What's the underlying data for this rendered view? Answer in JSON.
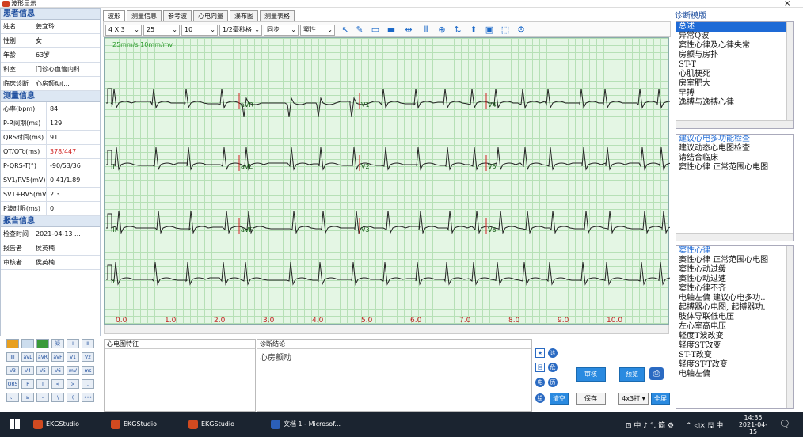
{
  "window": {
    "title": "波形显示",
    "close_glyph": "×"
  },
  "patient": {
    "header": "患者信息",
    "rows": [
      {
        "k": "姓名",
        "v": "姜宜玲"
      },
      {
        "k": "性别",
        "v": "女"
      },
      {
        "k": "年龄",
        "v": "63岁"
      },
      {
        "k": "科室",
        "v": "门诊心血管内科"
      },
      {
        "k": "临床诊断",
        "v": "心房颤动(..."
      }
    ]
  },
  "measure": {
    "header": "测量信息",
    "rows": [
      {
        "k": "心率(bpm)",
        "v": "84"
      },
      {
        "k": "P-R间期(ms)",
        "v": "129"
      },
      {
        "k": "QRS时间(ms)",
        "v": "91"
      },
      {
        "k": "QT/QTc(ms)",
        "v": "378/447"
      },
      {
        "k": "P-QRS-T(°)",
        "v": "-90/53/36"
      },
      {
        "k": "SV1/RV5(mV)",
        "v": "0.41/1.89"
      },
      {
        "k": "SV1+RV5(mV)",
        "v": "2.3"
      },
      {
        "k": "P波时限(ms)",
        "v": "0"
      }
    ]
  },
  "report": {
    "header": "报告信息",
    "rows": [
      {
        "k": "检查时间",
        "v": "2021-04-13 ..."
      },
      {
        "k": "报告者",
        "v": "侯英楠"
      },
      {
        "k": "审核者",
        "v": "侯英楠"
      }
    ]
  },
  "tabs": [
    "波形",
    "测量信息",
    "参考波",
    "心电向量",
    "瀑布图",
    "测量表格"
  ],
  "toolbar": {
    "layout": "4 X 3",
    "speed": "25",
    "gain": "10",
    "filter": "1/2毫秒格",
    "sync": "同步",
    "rhythm": "窦性"
  },
  "ecg": {
    "speed_label": "25mm/s   10mm/mv",
    "leads": [
      [
        "I",
        "aVR",
        "V1",
        "V4"
      ],
      [
        "II",
        "aVL",
        "V2",
        "V5"
      ],
      [
        "III",
        "aVF",
        "V3",
        "V6"
      ],
      [
        "II",
        "",
        "",
        ""
      ]
    ],
    "ticks": [
      "0.0",
      "1.0",
      "2.0",
      "3.0",
      "4.0",
      "5.0",
      "6.0",
      "7.0",
      "8.0",
      "9.0",
      "10.0"
    ]
  },
  "keypad": {
    "row1": [
      "",
      "",
      "",
      "疑",
      "I",
      "II"
    ],
    "row2": [
      "III",
      "aVL",
      "aVR",
      "aVF",
      "V1",
      "V2"
    ],
    "row3": [
      "V3",
      "V4",
      "V5",
      "V6",
      "mV",
      "ms"
    ],
    "row4": [
      "QRS",
      "P",
      "T",
      "<",
      ">",
      ","
    ],
    "row5": [
      "、",
      "≥",
      "-",
      "\\",
      "(",
      "•••"
    ]
  },
  "features": {
    "title": "心电图特征"
  },
  "conclusion": {
    "title": "诊断结论",
    "text": "心房颤动"
  },
  "actions": {
    "review": "审核",
    "preview": "预览",
    "clear": "清空",
    "save": "保存",
    "print_mode": "4x3打",
    "fullscreen": "全屏"
  },
  "side_icons": [
    "★",
    "诊",
    "目",
    "危",
    "电",
    "历",
    "绘"
  ],
  "diagnosis": {
    "title": "诊断模版",
    "categories": [
      "总述",
      "异常Q波",
      "窦性心律及心律失常",
      "房颤与房扑",
      "ST-T",
      "心肌梗死",
      "房室肥大",
      "早搏",
      "逸搏与逸搏心律"
    ],
    "suggestions": [
      "建议心电多功能检查",
      "建议动态心电图检查",
      "请结合临床",
      "窦性心律  正常范围心电图"
    ],
    "details": [
      "窦性心律",
      "窦性心律  正常范围心电图",
      "窦性心动过缓",
      "窦性心动过速",
      "窦性心律不齐",
      "电轴左偏  建议心电多功..",
      "起搏器心电图,  起搏器功.",
      "肢体导联低电压",
      "左心室高电压",
      "轻度T波改变",
      "轻度ST改变",
      "ST-T改变",
      "轻度ST-T改变",
      "电轴左偏"
    ]
  },
  "taskbar": {
    "items": [
      "EKGStudio",
      "EKGStudio",
      "EKGStudio",
      "文档 1 - Microsof..."
    ],
    "tray": "中 ♪ °, 简 ⚙",
    "tray2": "^ ◁× 🖫 中",
    "time": "14:35",
    "date": "2021-04-15"
  }
}
